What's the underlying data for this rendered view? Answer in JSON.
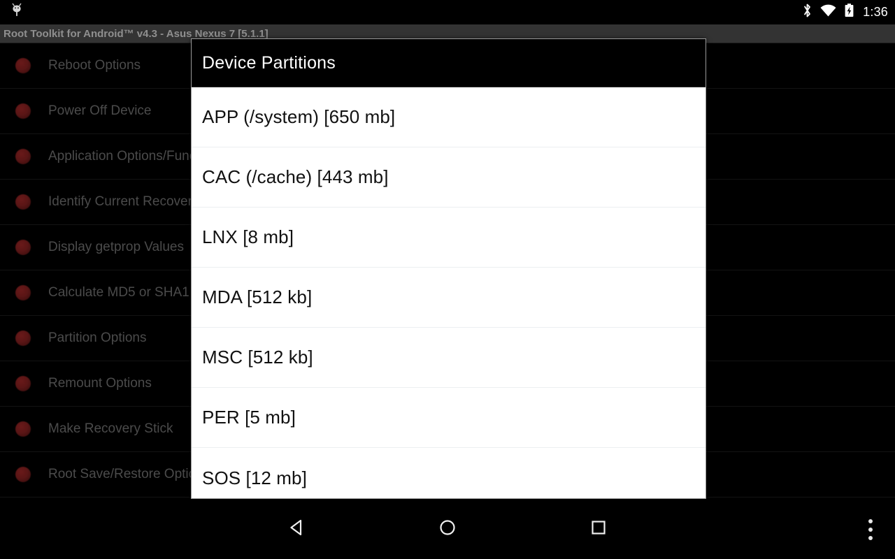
{
  "status_bar": {
    "icons": [
      "android-head-icon",
      "bluetooth-icon",
      "wifi-icon",
      "battery-charging-icon"
    ],
    "clock": "1:36"
  },
  "app_title_bar": {
    "title": "Root Toolkit for Android™ v4.3 - Asus Nexus 7 [5.1.1]"
  },
  "background_list": {
    "items": [
      {
        "label": "Reboot Options"
      },
      {
        "label": "Power Off Device"
      },
      {
        "label": "Application Options/Functions"
      },
      {
        "label": "Identify Current Recovery"
      },
      {
        "label": "Display getprop Values"
      },
      {
        "label": "Calculate MD5 or SHA1"
      },
      {
        "label": "Partition Options"
      },
      {
        "label": "Remount Options"
      },
      {
        "label": "Make Recovery Stick"
      },
      {
        "label": "Root Save/Restore Options"
      }
    ]
  },
  "dialog": {
    "title": "Device Partitions",
    "partitions": [
      {
        "label": "APP (/system) [650 mb]"
      },
      {
        "label": "CAC (/cache) [443 mb]"
      },
      {
        "label": "LNX [8 mb]"
      },
      {
        "label": "MDA [512 kb]"
      },
      {
        "label": "MSC [512 kb]"
      },
      {
        "label": "PER [5 mb]"
      },
      {
        "label": "SOS [12 mb]"
      }
    ]
  },
  "nav_bar": {
    "back": "back-icon",
    "home": "home-icon",
    "recents": "recents-icon",
    "overflow": "overflow-menu-icon"
  },
  "colors": {
    "dialog_header_bg": "#000000",
    "dialog_body_bg": "#ffffff",
    "title_bar_bg": "#333333",
    "accent_bullet": "#6b1a1a",
    "screen_bg": "#000000"
  }
}
